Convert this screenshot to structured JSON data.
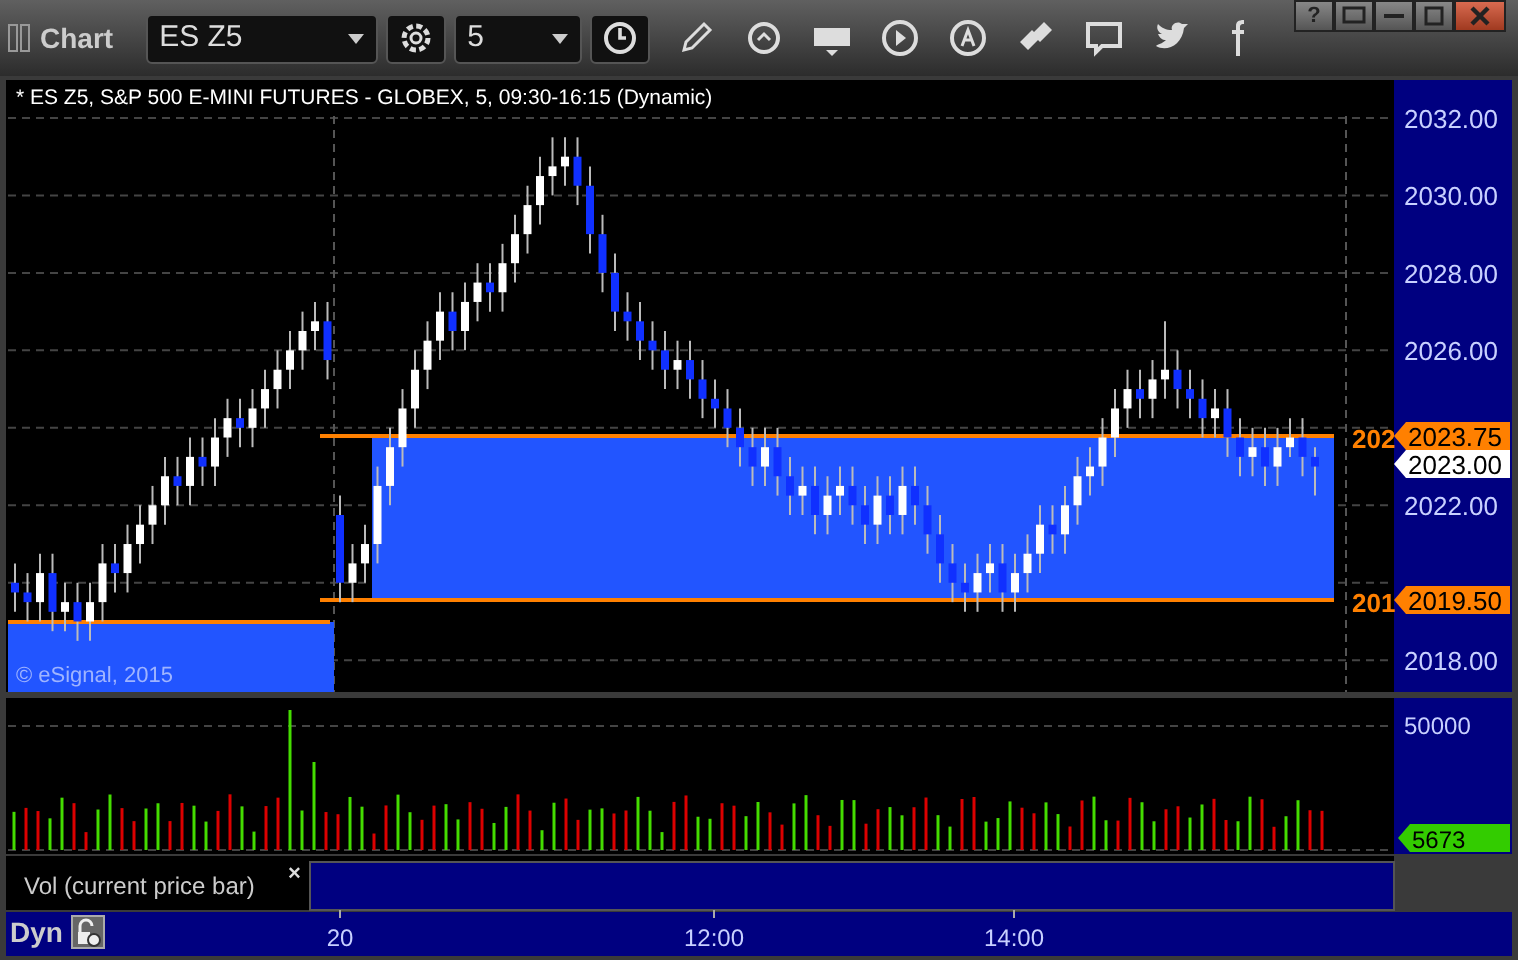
{
  "window": {
    "title": "Chart",
    "controls": [
      {
        "kind": "help",
        "label": "?"
      },
      {
        "kind": "popout"
      },
      {
        "kind": "minimize"
      },
      {
        "kind": "maximize"
      },
      {
        "kind": "close"
      }
    ]
  },
  "toolbar": {
    "symbol": "ES Z5",
    "interval": "5"
  },
  "chart": {
    "title": "* ES Z5, S&P 500 E-MINI FUTURES - GLOBEX, 5, 09:30-16:15 (Dynamic)",
    "chart_data": {
      "type": "candlestick",
      "ylim": [
        2017.18,
        2032.98
      ],
      "yticks": [
        {
          "value": 2032,
          "label": "2032.00"
        },
        {
          "value": 2030,
          "label": "2030.00"
        },
        {
          "value": 2028,
          "label": "2028.00"
        },
        {
          "value": 2026,
          "label": "2026.00"
        },
        {
          "value": 2022,
          "label": "2022.00"
        },
        {
          "value": 2018,
          "label": "2018.00"
        }
      ],
      "ohlc": [
        [
          2020,
          2020.5,
          2019.25,
          2019.75
        ],
        [
          2019.75,
          2020.25,
          2019,
          2019.5
        ],
        [
          2019.5,
          2020.75,
          2019,
          2020.25
        ],
        [
          2020.25,
          2020.75,
          2018.75,
          2019.25
        ],
        [
          2019.25,
          2020,
          2018.75,
          2019.5
        ],
        [
          2019.5,
          2020,
          2018.5,
          2019
        ],
        [
          2019,
          2020,
          2018.5,
          2019.5
        ],
        [
          2019.5,
          2021,
          2019,
          2020.5
        ],
        [
          2020.5,
          2021,
          2019.75,
          2020.25
        ],
        [
          2020.25,
          2021.5,
          2019.75,
          2021
        ],
        [
          2021,
          2022,
          2020.5,
          2021.5
        ],
        [
          2021.5,
          2022.5,
          2021,
          2022
        ],
        [
          2022,
          2023.25,
          2021.5,
          2022.75
        ],
        [
          2022.75,
          2023.25,
          2022,
          2022.5
        ],
        [
          2022.5,
          2023.75,
          2022,
          2023.25
        ],
        [
          2023.25,
          2023.75,
          2022.5,
          2023
        ],
        [
          2023,
          2024.25,
          2022.5,
          2023.75
        ],
        [
          2023.75,
          2024.75,
          2023.25,
          2024.25
        ],
        [
          2024.25,
          2024.75,
          2023.5,
          2024
        ],
        [
          2024,
          2025,
          2023.5,
          2024.5
        ],
        [
          2024.5,
          2025.5,
          2024,
          2025
        ],
        [
          2025,
          2026,
          2024.5,
          2025.5
        ],
        [
          2025.5,
          2026.5,
          2025,
          2026
        ],
        [
          2026,
          2027,
          2025.5,
          2026.5
        ],
        [
          2026.5,
          2027.25,
          2026,
          2026.75
        ],
        [
          2026.75,
          2027.25,
          2025.25,
          2025.75
        ],
        [
          2021.75,
          2022.25,
          2019.5,
          2020
        ],
        [
          2020,
          2021,
          2019.5,
          2020.5
        ],
        [
          2020.5,
          2021.5,
          2020,
          2021
        ],
        [
          2021,
          2023,
          2020.5,
          2022.5
        ],
        [
          2022.5,
          2024,
          2022,
          2023.5
        ],
        [
          2023.5,
          2025,
          2023,
          2024.5
        ],
        [
          2024.5,
          2026,
          2024,
          2025.5
        ],
        [
          2025.5,
          2026.75,
          2025,
          2026.25
        ],
        [
          2026.25,
          2027.5,
          2025.75,
          2027
        ],
        [
          2027,
          2027.5,
          2026,
          2026.5
        ],
        [
          2026.5,
          2027.75,
          2026,
          2027.25
        ],
        [
          2027.25,
          2028.25,
          2026.75,
          2027.75
        ],
        [
          2027.75,
          2028.25,
          2027,
          2027.5
        ],
        [
          2027.5,
          2028.75,
          2027,
          2028.25
        ],
        [
          2028.25,
          2029.5,
          2027.75,
          2029
        ],
        [
          2029,
          2030.25,
          2028.5,
          2029.75
        ],
        [
          2029.75,
          2031,
          2029.25,
          2030.5
        ],
        [
          2030.5,
          2031.5,
          2030,
          2030.75
        ],
        [
          2030.75,
          2031.5,
          2030.25,
          2031
        ],
        [
          2031,
          2031.5,
          2029.75,
          2030.25
        ],
        [
          2030.25,
          2030.75,
          2028.5,
          2029
        ],
        [
          2029,
          2029.5,
          2027.5,
          2028
        ],
        [
          2028,
          2028.5,
          2026.5,
          2027
        ],
        [
          2027,
          2027.5,
          2026.25,
          2026.75
        ],
        [
          2026.75,
          2027.25,
          2025.75,
          2026.25
        ],
        [
          2026.25,
          2026.75,
          2025.5,
          2026
        ],
        [
          2026,
          2026.5,
          2025,
          2025.5
        ],
        [
          2025.5,
          2026.25,
          2025,
          2025.75
        ],
        [
          2025.75,
          2026.25,
          2024.75,
          2025.25
        ],
        [
          2025.25,
          2025.75,
          2024.25,
          2024.75
        ],
        [
          2024.75,
          2025.25,
          2024,
          2024.5
        ],
        [
          2024.5,
          2025,
          2023.5,
          2024
        ],
        [
          2024,
          2024.5,
          2023,
          2023.5
        ],
        [
          2023.5,
          2024,
          2022.5,
          2023
        ],
        [
          2023,
          2024,
          2022.5,
          2023.5
        ],
        [
          2023.5,
          2024,
          2022.25,
          2022.75
        ],
        [
          2022.75,
          2023.25,
          2021.75,
          2022.25
        ],
        [
          2022.25,
          2023,
          2021.75,
          2022.5
        ],
        [
          2022.5,
          2023,
          2021.25,
          2021.75
        ],
        [
          2021.75,
          2022.75,
          2021.25,
          2022.25
        ],
        [
          2022.25,
          2023,
          2021.75,
          2022.5
        ],
        [
          2022.5,
          2023,
          2021.5,
          2022
        ],
        [
          2022,
          2022.5,
          2021,
          2021.5
        ],
        [
          2021.5,
          2022.75,
          2021,
          2022.25
        ],
        [
          2022.25,
          2022.75,
          2021.25,
          2021.75
        ],
        [
          2021.75,
          2023,
          2021.25,
          2022.5
        ],
        [
          2022.5,
          2023,
          2021.5,
          2022
        ],
        [
          2022,
          2022.5,
          2020.75,
          2021.25
        ],
        [
          2021.25,
          2021.75,
          2020,
          2020.5
        ],
        [
          2020.5,
          2021,
          2019.5,
          2020
        ],
        [
          2020,
          2020.5,
          2019.25,
          2019.75
        ],
        [
          2019.75,
          2020.75,
          2019.25,
          2020.25
        ],
        [
          2020.25,
          2021,
          2019.75,
          2020.5
        ],
        [
          2020.5,
          2021,
          2019.25,
          2019.75
        ],
        [
          2019.75,
          2020.75,
          2019.25,
          2020.25
        ],
        [
          2020.25,
          2021.25,
          2019.75,
          2020.75
        ],
        [
          2020.75,
          2022,
          2020.25,
          2021.5
        ],
        [
          2021.5,
          2022,
          2020.75,
          2021.25
        ],
        [
          2021.25,
          2022.5,
          2020.75,
          2022
        ],
        [
          2022,
          2023.25,
          2021.5,
          2022.75
        ],
        [
          2022.75,
          2023.5,
          2022.25,
          2023
        ],
        [
          2023,
          2024.25,
          2022.5,
          2023.75
        ],
        [
          2023.75,
          2025,
          2023.25,
          2024.5
        ],
        [
          2024.5,
          2025.5,
          2024,
          2025
        ],
        [
          2025,
          2025.5,
          2024.25,
          2024.75
        ],
        [
          2024.75,
          2025.75,
          2024.25,
          2025.25
        ],
        [
          2025.25,
          2026.75,
          2024.75,
          2025.5
        ],
        [
          2025.5,
          2026,
          2024.5,
          2025
        ],
        [
          2025,
          2025.5,
          2024.25,
          2024.75
        ],
        [
          2024.75,
          2025.25,
          2023.75,
          2024.25
        ],
        [
          2024.25,
          2025,
          2023.75,
          2024.5
        ],
        [
          2024.5,
          2025,
          2023.25,
          2023.75
        ],
        [
          2023.75,
          2024.25,
          2022.75,
          2023.25
        ],
        [
          2023.25,
          2024,
          2022.75,
          2023.5
        ],
        [
          2023.5,
          2024,
          2022.5,
          2023
        ],
        [
          2023,
          2024,
          2022.5,
          2023.5
        ],
        [
          2023.5,
          2024.25,
          2023.25,
          2023.75
        ],
        [
          2023.75,
          2024.25,
          2022.75,
          2023.25
        ],
        [
          2023.25,
          2023.5,
          2022.25,
          2023
        ]
      ]
    },
    "level_labels": [
      "202",
      "201"
    ],
    "markers": [
      {
        "label": "2023.75",
        "color": "#ff8000"
      },
      {
        "label": "2023.00",
        "color": "#ffffff"
      },
      {
        "label": "2019.50",
        "color": "#ff8000"
      }
    ],
    "copyright": "© eSignal, 2015"
  },
  "volume": {
    "axis": [
      "50000"
    ],
    "marker": {
      "label": "5673",
      "color": "#33cc00"
    },
    "legend": "Vol (current price bar)",
    "close": "×"
  },
  "status_bar": {
    "mode": "Dyn",
    "time_labels": [
      "20",
      "12:00",
      "14:00"
    ]
  }
}
